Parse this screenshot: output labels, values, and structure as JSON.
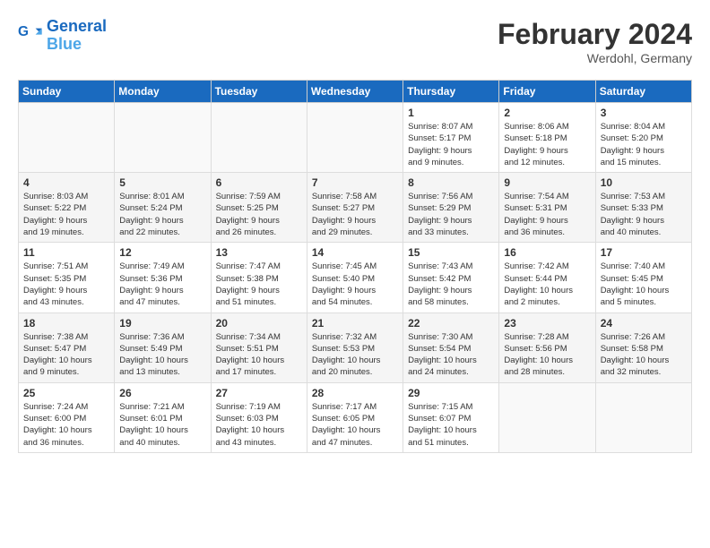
{
  "header": {
    "logo_general": "General",
    "logo_blue": "Blue",
    "month_title": "February 2024",
    "subtitle": "Werdohl, Germany"
  },
  "weekdays": [
    "Sunday",
    "Monday",
    "Tuesday",
    "Wednesday",
    "Thursday",
    "Friday",
    "Saturday"
  ],
  "weeks": [
    [
      {
        "day": "",
        "info": ""
      },
      {
        "day": "",
        "info": ""
      },
      {
        "day": "",
        "info": ""
      },
      {
        "day": "",
        "info": ""
      },
      {
        "day": "1",
        "info": "Sunrise: 8:07 AM\nSunset: 5:17 PM\nDaylight: 9 hours\nand 9 minutes."
      },
      {
        "day": "2",
        "info": "Sunrise: 8:06 AM\nSunset: 5:18 PM\nDaylight: 9 hours\nand 12 minutes."
      },
      {
        "day": "3",
        "info": "Sunrise: 8:04 AM\nSunset: 5:20 PM\nDaylight: 9 hours\nand 15 minutes."
      }
    ],
    [
      {
        "day": "4",
        "info": "Sunrise: 8:03 AM\nSunset: 5:22 PM\nDaylight: 9 hours\nand 19 minutes."
      },
      {
        "day": "5",
        "info": "Sunrise: 8:01 AM\nSunset: 5:24 PM\nDaylight: 9 hours\nand 22 minutes."
      },
      {
        "day": "6",
        "info": "Sunrise: 7:59 AM\nSunset: 5:25 PM\nDaylight: 9 hours\nand 26 minutes."
      },
      {
        "day": "7",
        "info": "Sunrise: 7:58 AM\nSunset: 5:27 PM\nDaylight: 9 hours\nand 29 minutes."
      },
      {
        "day": "8",
        "info": "Sunrise: 7:56 AM\nSunset: 5:29 PM\nDaylight: 9 hours\nand 33 minutes."
      },
      {
        "day": "9",
        "info": "Sunrise: 7:54 AM\nSunset: 5:31 PM\nDaylight: 9 hours\nand 36 minutes."
      },
      {
        "day": "10",
        "info": "Sunrise: 7:53 AM\nSunset: 5:33 PM\nDaylight: 9 hours\nand 40 minutes."
      }
    ],
    [
      {
        "day": "11",
        "info": "Sunrise: 7:51 AM\nSunset: 5:35 PM\nDaylight: 9 hours\nand 43 minutes."
      },
      {
        "day": "12",
        "info": "Sunrise: 7:49 AM\nSunset: 5:36 PM\nDaylight: 9 hours\nand 47 minutes."
      },
      {
        "day": "13",
        "info": "Sunrise: 7:47 AM\nSunset: 5:38 PM\nDaylight: 9 hours\nand 51 minutes."
      },
      {
        "day": "14",
        "info": "Sunrise: 7:45 AM\nSunset: 5:40 PM\nDaylight: 9 hours\nand 54 minutes."
      },
      {
        "day": "15",
        "info": "Sunrise: 7:43 AM\nSunset: 5:42 PM\nDaylight: 9 hours\nand 58 minutes."
      },
      {
        "day": "16",
        "info": "Sunrise: 7:42 AM\nSunset: 5:44 PM\nDaylight: 10 hours\nand 2 minutes."
      },
      {
        "day": "17",
        "info": "Sunrise: 7:40 AM\nSunset: 5:45 PM\nDaylight: 10 hours\nand 5 minutes."
      }
    ],
    [
      {
        "day": "18",
        "info": "Sunrise: 7:38 AM\nSunset: 5:47 PM\nDaylight: 10 hours\nand 9 minutes."
      },
      {
        "day": "19",
        "info": "Sunrise: 7:36 AM\nSunset: 5:49 PM\nDaylight: 10 hours\nand 13 minutes."
      },
      {
        "day": "20",
        "info": "Sunrise: 7:34 AM\nSunset: 5:51 PM\nDaylight: 10 hours\nand 17 minutes."
      },
      {
        "day": "21",
        "info": "Sunrise: 7:32 AM\nSunset: 5:53 PM\nDaylight: 10 hours\nand 20 minutes."
      },
      {
        "day": "22",
        "info": "Sunrise: 7:30 AM\nSunset: 5:54 PM\nDaylight: 10 hours\nand 24 minutes."
      },
      {
        "day": "23",
        "info": "Sunrise: 7:28 AM\nSunset: 5:56 PM\nDaylight: 10 hours\nand 28 minutes."
      },
      {
        "day": "24",
        "info": "Sunrise: 7:26 AM\nSunset: 5:58 PM\nDaylight: 10 hours\nand 32 minutes."
      }
    ],
    [
      {
        "day": "25",
        "info": "Sunrise: 7:24 AM\nSunset: 6:00 PM\nDaylight: 10 hours\nand 36 minutes."
      },
      {
        "day": "26",
        "info": "Sunrise: 7:21 AM\nSunset: 6:01 PM\nDaylight: 10 hours\nand 40 minutes."
      },
      {
        "day": "27",
        "info": "Sunrise: 7:19 AM\nSunset: 6:03 PM\nDaylight: 10 hours\nand 43 minutes."
      },
      {
        "day": "28",
        "info": "Sunrise: 7:17 AM\nSunset: 6:05 PM\nDaylight: 10 hours\nand 47 minutes."
      },
      {
        "day": "29",
        "info": "Sunrise: 7:15 AM\nSunset: 6:07 PM\nDaylight: 10 hours\nand 51 minutes."
      },
      {
        "day": "",
        "info": ""
      },
      {
        "day": "",
        "info": ""
      }
    ]
  ]
}
